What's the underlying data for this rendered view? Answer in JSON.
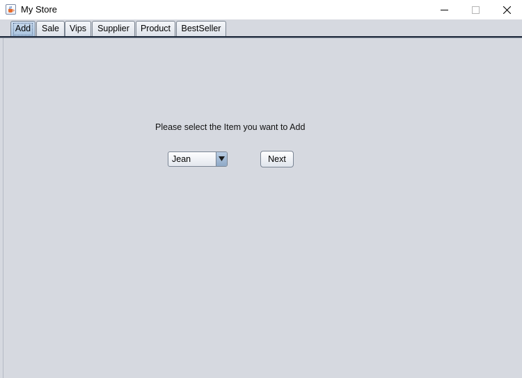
{
  "window": {
    "title": "My Store",
    "icon": "java-cup-icon",
    "controls": [
      "minimize-icon",
      "maximize-icon",
      "close-icon"
    ]
  },
  "tabs": [
    {
      "label": "Add",
      "selected": true
    },
    {
      "label": "Sale"
    },
    {
      "label": "Vips"
    },
    {
      "label": "Supplier"
    },
    {
      "label": "Product"
    },
    {
      "label": "BestSeller"
    }
  ],
  "add_panel": {
    "prompt": "Please select the Item you want to Add",
    "item_select": {
      "selected": "Jean"
    },
    "next_label": "Next"
  },
  "colors": {
    "panel_bg": "#d6d9e0",
    "selected_tab": "#b8cde5"
  }
}
